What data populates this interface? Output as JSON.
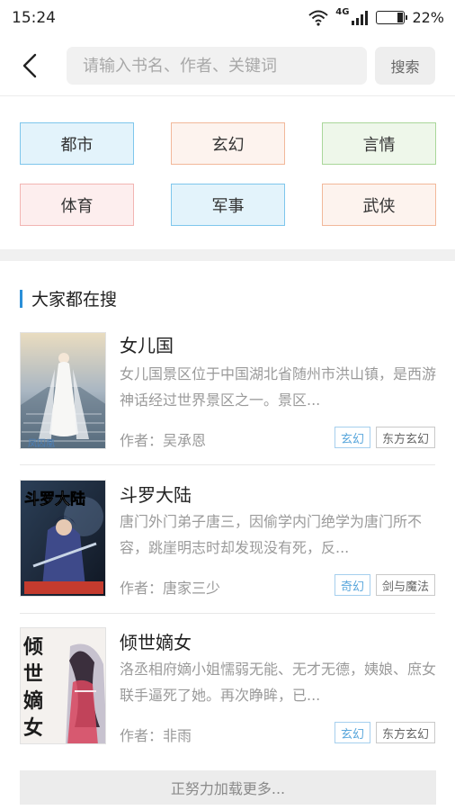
{
  "status_bar": {
    "time": "15:24",
    "network": "4G",
    "battery": "22%",
    "battery_level": 0.22
  },
  "search": {
    "placeholder": "请输入书名、作者、关键词",
    "value": "",
    "button_label": "搜索"
  },
  "categories": [
    {
      "label": "都市",
      "bg": "#e3f3fb",
      "border": "#7ec6ec"
    },
    {
      "label": "玄幻",
      "bg": "#fdf3ee",
      "border": "#f2b89a"
    },
    {
      "label": "言情",
      "bg": "#eef7ea",
      "border": "#a9d79a"
    },
    {
      "label": "体育",
      "bg": "#fdeeee",
      "border": "#f2b5b3"
    },
    {
      "label": "军事",
      "bg": "#e3f3fb",
      "border": "#7ec6ec"
    },
    {
      "label": "武侠",
      "bg": "#fdf3ee",
      "border": "#f2b89a"
    }
  ],
  "section": {
    "title": "大家都在搜",
    "accent": "#2a8fd8"
  },
  "books": [
    {
      "title": "女儿国",
      "description": "女儿国景区位于中国湖北省随州市洪山镇，是西游神话经过世界景区之一。景区...",
      "author": "作者：吴承恩",
      "tags": [
        "玄幻",
        "东方玄幻"
      ],
      "cover_icon": "cover-bride"
    },
    {
      "title": "斗罗大陆",
      "description": "唐门外门弟子唐三，因偷学内门绝学为唐门所不容，跳崖明志时却发现没有死，反...",
      "author": "作者：唐家三少",
      "tags": [
        "奇幻",
        "剑与魔法"
      ],
      "cover_icon": "cover-warrior",
      "cover_title": "斗罗大陆"
    },
    {
      "title": "倾世嫡女",
      "description": "洛丞相府嫡小姐懦弱无能、无才无德，姨娘、庶女联手逼死了她。再次睁眸，已...",
      "author": "作者：非雨",
      "tags": [
        "玄幻",
        "东方玄幻"
      ],
      "cover_icon": "cover-lady",
      "cover_title": "倾世嫡女"
    }
  ],
  "load_more": "正努力加载更多..."
}
